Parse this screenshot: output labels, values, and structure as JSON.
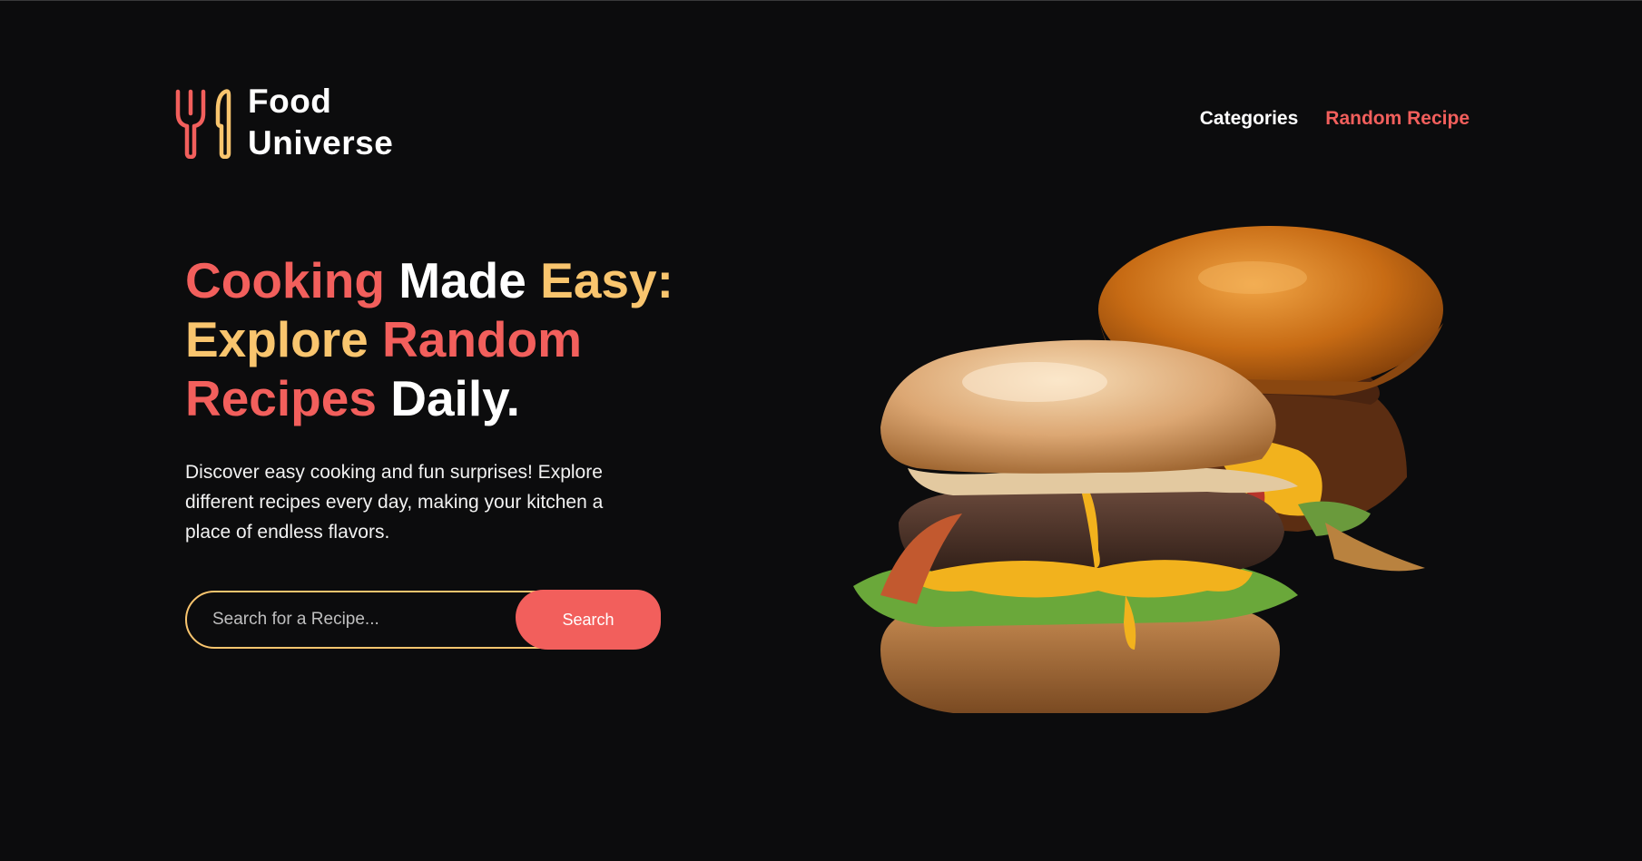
{
  "brand": {
    "name_line1": "Food",
    "name_line2": "Universe",
    "logo_icon": "fork-knife-icon",
    "colors": {
      "red": "#f25f5c",
      "yellow": "#f9c56e",
      "background": "#0c0c0d"
    }
  },
  "nav": {
    "categories": "Categories",
    "random_recipe": "Random Recipe"
  },
  "hero": {
    "title_word1": "Cooking",
    "title_word2": "Made",
    "title_word3": "Easy:",
    "title_word4": "Explore",
    "title_word5": "Random",
    "title_word6": "Recipes",
    "title_word7": "Daily.",
    "description": "Discover easy cooking and fun surprises! Explore different recipes every day, making your kitchen a place of endless flavors."
  },
  "search": {
    "placeholder": "Search for a Recipe...",
    "value": "",
    "button_label": "Search"
  },
  "hero_image": {
    "subject": "double cheeseburger"
  }
}
